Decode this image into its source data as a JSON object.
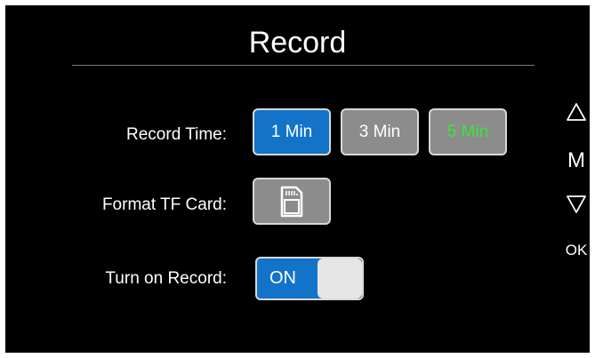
{
  "screen": {
    "title": "Record"
  },
  "record_time": {
    "label": "Record Time:",
    "options": [
      "1 Min",
      "3 Min",
      "5 Min"
    ],
    "selected": "1 Min"
  },
  "format_card": {
    "label": "Format TF Card:",
    "icon": "sd-card-icon"
  },
  "turn_on_record": {
    "label": "Turn on Record:",
    "state_label": "ON"
  },
  "side_controls": {
    "m_label": "M",
    "ok_label": "OK",
    "up_icon": "triangle-up-icon",
    "down_icon": "triangle-down-icon"
  },
  "colors": {
    "background": "#000000",
    "selected": "#1273c9",
    "unselected": "#8c8c8c",
    "highlight_text": "#39e639"
  }
}
